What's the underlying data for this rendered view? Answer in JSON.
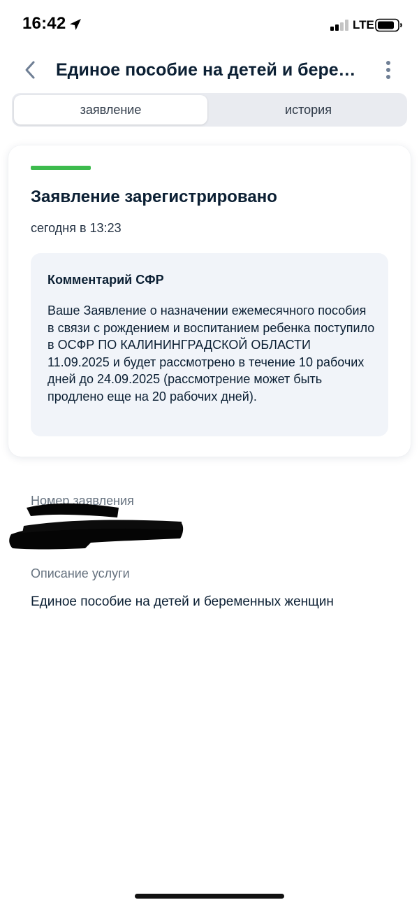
{
  "status_bar": {
    "time": "16:42",
    "network": "LTE",
    "icons": [
      "location-arrow-icon",
      "cellular-signal-icon",
      "battery-icon"
    ]
  },
  "header": {
    "title": "Единое пособие на детей и беременных женщин",
    "back_icon": "chevron-left-icon",
    "more_icon": "more-vertical-icon"
  },
  "tabs": [
    {
      "label": "заявление",
      "active": true
    },
    {
      "label": "история",
      "active": false
    }
  ],
  "status_card": {
    "title": "Заявление зарегистрировано",
    "date": "сегодня в 13:23",
    "comment": {
      "title": "Комментарий СФР",
      "text": "Ваше Заявление о назначении ежемесячного пособия в связи с рождением и воспитанием ребенка поступило в ОСФР ПО КАЛИНИНГРАДСКОЙ ОБЛАСТИ 11.09.2025 и будет рассмотрено в течение 10 рабочих дней до 24.09.2025 (рассмотрение может быть продлено еще на 20 рабочих дней)."
    }
  },
  "details": {
    "application_number_label": "Номер заявления",
    "service_description_label": "Описание услуги",
    "service_description": "Единое пособие на детей и беременных женщин"
  },
  "colors": {
    "status_stripe": "#3dbb4d",
    "tabs_background": "#e9ebf0",
    "comment_background": "#f1f4f9",
    "primary_text": "#0b1f33",
    "secondary_text": "#66727f"
  }
}
